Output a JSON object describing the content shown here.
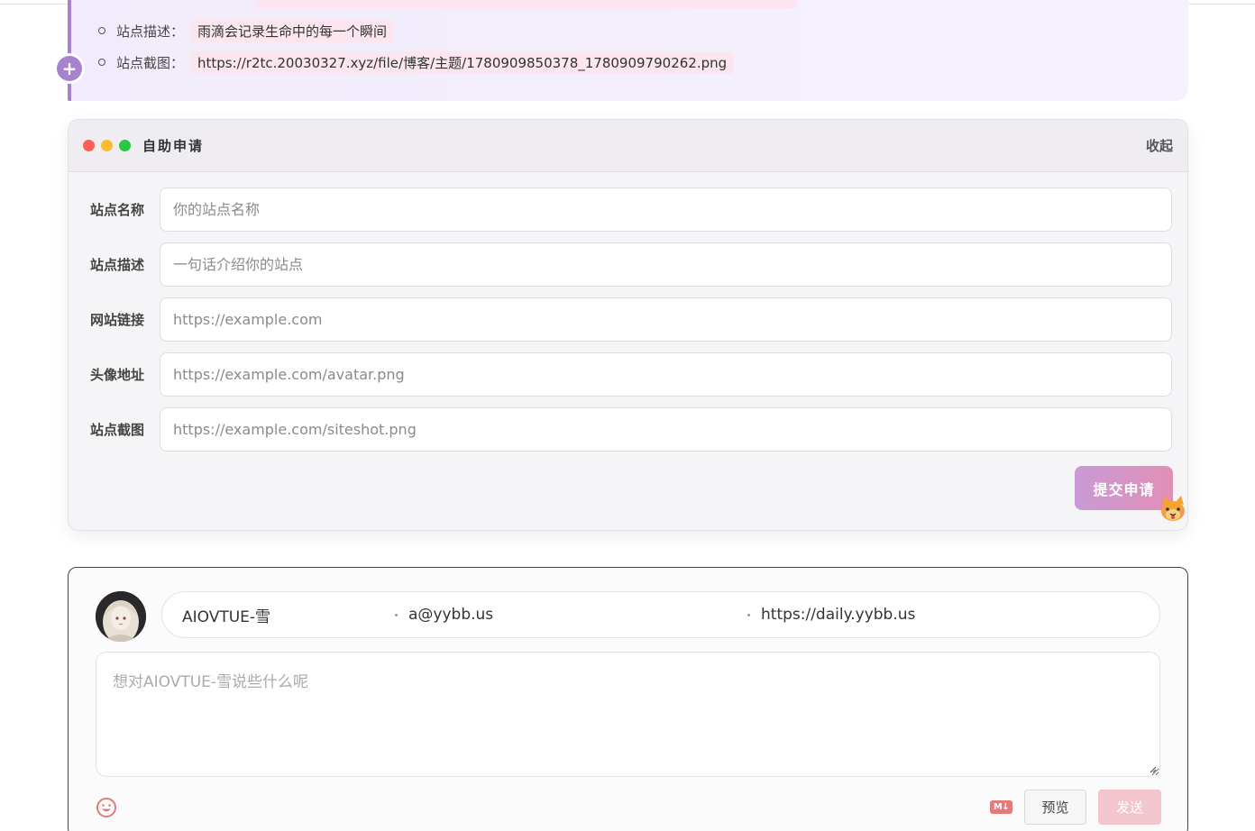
{
  "site_info": {
    "items": [
      {
        "key": "站点描述：",
        "value": "雨滴会记录生命中的每一个瞬间"
      },
      {
        "key": "站点截图：",
        "value": "https://r2tc.20030327.xyz/file/博客/主题/1780909850378_1780909790262.png"
      }
    ]
  },
  "apply": {
    "title": "自助申请",
    "collapse_label": "收起",
    "fields": [
      {
        "label": "站点名称",
        "placeholder": "你的站点名称"
      },
      {
        "label": "站点描述",
        "placeholder": "一句话介绍你的站点"
      },
      {
        "label": "网站链接",
        "placeholder": "https://example.com"
      },
      {
        "label": "头像地址",
        "placeholder": "https://example.com/avatar.png"
      },
      {
        "label": "站点截图",
        "placeholder": "https://example.com/siteshot.png"
      }
    ],
    "submit_label": "提交申请"
  },
  "comment": {
    "nickname": "AIOVTUE-雪",
    "email": "a@yybb.us",
    "website": "https://daily.yybb.us",
    "textarea_placeholder": "想对AIOVTUE-雪说些什么呢",
    "md_label": "M↓",
    "preview_label": "预览",
    "send_label": "发送"
  },
  "colors": {
    "accent_purple": "#a682cf",
    "submit_gradient_start": "#c89ad6",
    "submit_gradient_end": "#e28fb5",
    "send_disabled": "#f3c5cc"
  },
  "icons": [
    "plus-icon",
    "window-dots",
    "cat-mascot-icon",
    "avatar-image",
    "emoji-icon",
    "markdown-icon",
    "resize-grip-icon"
  ]
}
